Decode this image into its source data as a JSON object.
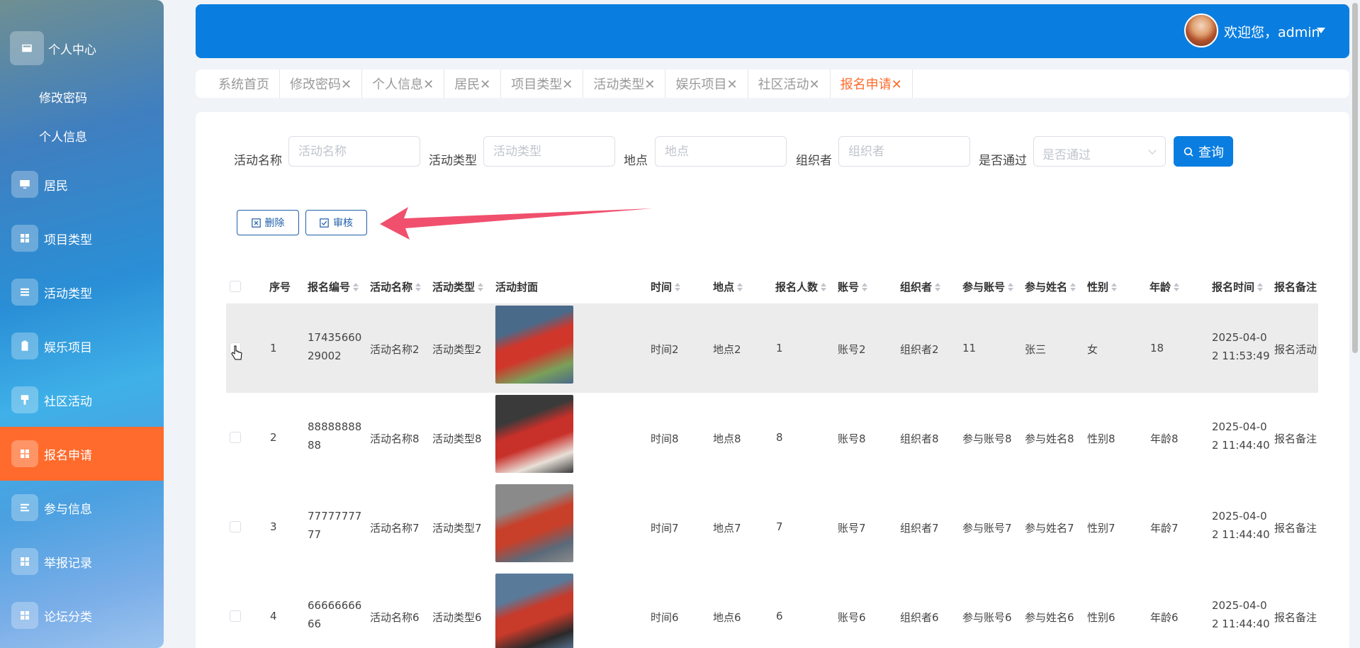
{
  "sidebar": {
    "personal_center": "个人中心",
    "sub_items": [
      "修改密码",
      "个人信息"
    ],
    "items": [
      "居民",
      "项目类型",
      "活动类型",
      "娱乐项目",
      "社区活动",
      "报名申请",
      "参与信息",
      "举报记录",
      "论坛分类"
    ],
    "active": "报名申请"
  },
  "header": {
    "welcome": "欢迎您，admin"
  },
  "tabs": [
    {
      "label": "系统首页"
    },
    {
      "label": "修改密码✕"
    },
    {
      "label": "个人信息✕"
    },
    {
      "label": "居民✕"
    },
    {
      "label": "项目类型✕"
    },
    {
      "label": "活动类型✕"
    },
    {
      "label": "娱乐项目✕"
    },
    {
      "label": "社区活动✕"
    },
    {
      "label": "报名申请✕",
      "active": true
    }
  ],
  "filters": {
    "activity_name": {
      "label": "活动名称",
      "placeholder": "活动名称"
    },
    "activity_type": {
      "label": "活动类型",
      "placeholder": "活动类型"
    },
    "location": {
      "label": "地点",
      "placeholder": "地点"
    },
    "organizer": {
      "label": "组织者",
      "placeholder": "组织者"
    },
    "approved": {
      "label": "是否通过",
      "placeholder": "是否通过"
    },
    "query_button": "查询"
  },
  "actions": {
    "delete": "删除",
    "review": "审核"
  },
  "table": {
    "headers": [
      "序号",
      "报名编号",
      "活动名称",
      "活动类型",
      "活动封面",
      "时间",
      "地点",
      "报名人数",
      "账号",
      "组织者",
      "参与账号",
      "参与姓名",
      "性别",
      "年龄",
      "报名时间",
      "报名备注"
    ],
    "rows": [
      {
        "index": "1",
        "code": "1743566029002",
        "name": "活动名称2",
        "type": "活动类型2",
        "time": "时间2",
        "place": "地点2",
        "count": "1",
        "account": "账号2",
        "organizer": "组织者2",
        "p_account": "11",
        "p_name": "张三",
        "gender": "女",
        "age": "18",
        "apply_time": "2025-04-02 11:53:49",
        "note": "报名活动"
      },
      {
        "index": "2",
        "code": "8888888888",
        "name": "活动名称8",
        "type": "活动类型8",
        "time": "时间8",
        "place": "地点8",
        "count": "8",
        "account": "账号8",
        "organizer": "组织者8",
        "p_account": "参与账号8",
        "p_name": "参与姓名8",
        "gender": "性别8",
        "age": "年龄8",
        "apply_time": "2025-04-02 11:44:40",
        "note": "报名备注"
      },
      {
        "index": "3",
        "code": "7777777777",
        "name": "活动名称7",
        "type": "活动类型7",
        "time": "时间7",
        "place": "地点7",
        "count": "7",
        "account": "账号7",
        "organizer": "组织者7",
        "p_account": "参与账号7",
        "p_name": "参与姓名7",
        "gender": "性别7",
        "age": "年龄7",
        "apply_time": "2025-04-02 11:44:40",
        "note": "报名备注"
      },
      {
        "index": "4",
        "code": "6666666666",
        "name": "活动名称6",
        "type": "活动类型6",
        "time": "时间6",
        "place": "地点6",
        "count": "6",
        "account": "账号6",
        "organizer": "组织者6",
        "p_account": "参与账号6",
        "p_name": "参与姓名6",
        "gender": "性别6",
        "age": "年龄6",
        "apply_time": "2025-04-02 11:44:40",
        "note": "报名备注"
      }
    ]
  },
  "colors": {
    "primary": "#0a7ee0",
    "active_tab": "#ff6b2c",
    "arrow": "#f0506e"
  }
}
